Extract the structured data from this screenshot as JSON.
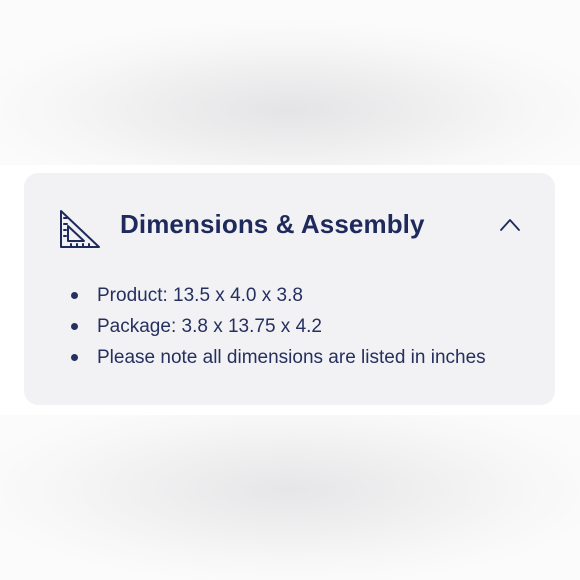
{
  "panel": {
    "title": "Dimensions & Assembly",
    "icon": "ruler-triangle-icon",
    "toggle_icon": "chevron-up-icon",
    "expanded": true,
    "items": [
      {
        "text": "Product: 13.5 x 4.0 x 3.8"
      },
      {
        "text": "Package: 3.8 x 13.75 x 4.2"
      },
      {
        "text": "Please note all dimensions are listed in inches"
      }
    ]
  },
  "colors": {
    "text": "#1f2a5c",
    "panel_background": "#f2f2f4"
  }
}
